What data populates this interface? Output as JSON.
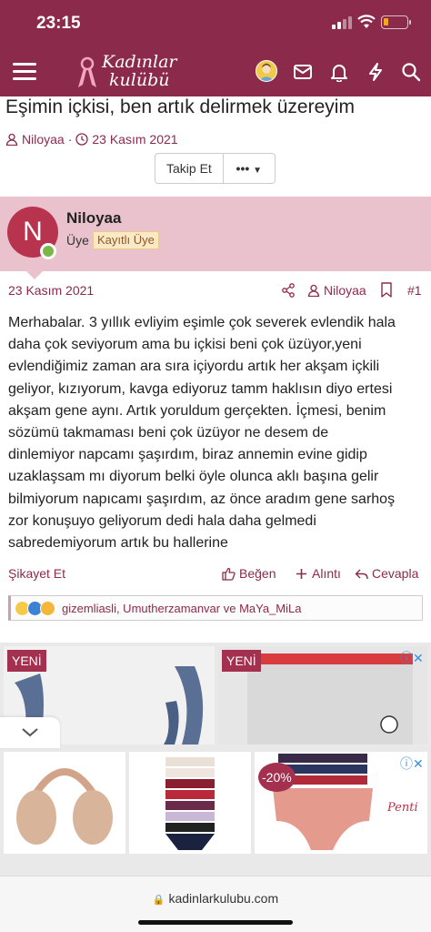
{
  "status_bar": {
    "time": "23:15"
  },
  "header": {
    "logo_line1": "Kadınlar",
    "logo_line2": "kulübü"
  },
  "thread": {
    "title": "Eşimin içkisi, ben artık delirmek üzereyim",
    "author": "Niloyaa",
    "separator": "·",
    "date": "23 Kasım 2021",
    "follow_label": "Takip Et",
    "more_label": "•••"
  },
  "user": {
    "initial": "N",
    "name": "Niloyaa",
    "role": "Üye",
    "badge": "Kayıtlı Üye"
  },
  "post": {
    "date": "23 Kasım 2021",
    "author": "Niloyaa",
    "number": "#1",
    "lines": [
      "Merhabalar. 3 yıllık evliyim eşimle çok severek evlendik hala",
      "daha çok seviyorum ama bu içkisi beni çok üzüyor,yeni",
      "evlendiğimiz zaman ara sıra içiyordu artık her akşam içkili",
      "geliyor, kızıyorum, kavga ediyoruz tamm haklısın diyo ertesi",
      "akşam gene aynı. Artık yoruldum gerçekten. İçmesi, benim",
      "sözümü takmaması beni çok üzüyor ne desem de",
      "dinlemiyor napcamı şaşırdım, biraz annemin evine gidip",
      "uzaklaşsam mı diyorum belki öyle olunca aklı başına gelir",
      "bilmiyorum napıcamı şaşırdım, az önce aradım gene sarhoş",
      "zor konuşuyo geliyorum dedi hala daha gelmedi",
      "sabredemiyorum artık bu hallerine"
    ],
    "report_label": "Şikayet Et",
    "like_label": "Beğen",
    "quote_label": "Alıntı",
    "reply_label": "Cevapla",
    "reaction_users": "gizemliasli, Umutherzamanvar ve MaYa_MiLa"
  },
  "ads": {
    "new_badge": "YENİ",
    "discount": "-20%",
    "brand": "Penti",
    "info": "ⓘ✕"
  },
  "browser": {
    "url": "kadinlarkulubu.com"
  },
  "colors": {
    "brand": "#8b2a4b",
    "user_box": "#eac2cd",
    "avatar": "#b8334d"
  }
}
